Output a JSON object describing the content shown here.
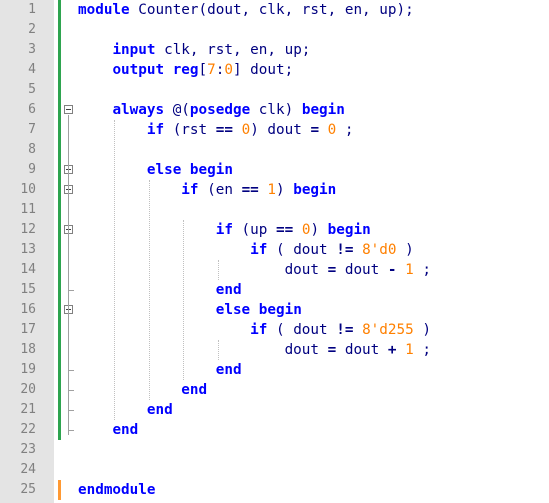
{
  "editor": {
    "lines": [
      {
        "n": "1",
        "tokens": [
          {
            "t": "module",
            "c": "kw"
          },
          {
            "t": " Counter(dout, clk, rst, en, up);",
            "c": "id"
          }
        ]
      },
      {
        "n": "2",
        "tokens": []
      },
      {
        "n": "3",
        "tokens": [
          {
            "t": "    ",
            "c": "id"
          },
          {
            "t": "input",
            "c": "kw"
          },
          {
            "t": " clk, rst, en, up;",
            "c": "id"
          }
        ]
      },
      {
        "n": "4",
        "tokens": [
          {
            "t": "    ",
            "c": "id"
          },
          {
            "t": "output",
            "c": "kw"
          },
          {
            "t": " ",
            "c": "id"
          },
          {
            "t": "reg",
            "c": "kw"
          },
          {
            "t": "[",
            "c": "id"
          },
          {
            "t": "7",
            "c": "num"
          },
          {
            "t": ":",
            "c": "id"
          },
          {
            "t": "0",
            "c": "num"
          },
          {
            "t": "] dout;",
            "c": "id"
          }
        ]
      },
      {
        "n": "5",
        "tokens": []
      },
      {
        "n": "6",
        "tokens": [
          {
            "t": "    ",
            "c": "id"
          },
          {
            "t": "always",
            "c": "kw"
          },
          {
            "t": " @(",
            "c": "id"
          },
          {
            "t": "posedge",
            "c": "kw"
          },
          {
            "t": " clk) ",
            "c": "id"
          },
          {
            "t": "begin",
            "c": "kw"
          }
        ]
      },
      {
        "n": "7",
        "tokens": [
          {
            "t": "        ",
            "c": "id"
          },
          {
            "t": "if",
            "c": "kw"
          },
          {
            "t": " (rst ",
            "c": "id"
          },
          {
            "t": "==",
            "c": "op"
          },
          {
            "t": " ",
            "c": "id"
          },
          {
            "t": "0",
            "c": "num"
          },
          {
            "t": ") dout ",
            "c": "id"
          },
          {
            "t": "=",
            "c": "op"
          },
          {
            "t": " ",
            "c": "id"
          },
          {
            "t": "0",
            "c": "num"
          },
          {
            "t": " ;",
            "c": "id"
          }
        ]
      },
      {
        "n": "8",
        "tokens": []
      },
      {
        "n": "9",
        "tokens": [
          {
            "t": "        ",
            "c": "id"
          },
          {
            "t": "else",
            "c": "kw"
          },
          {
            "t": " ",
            "c": "id"
          },
          {
            "t": "begin",
            "c": "kw"
          }
        ]
      },
      {
        "n": "10",
        "tokens": [
          {
            "t": "            ",
            "c": "id"
          },
          {
            "t": "if",
            "c": "kw"
          },
          {
            "t": " (en ",
            "c": "id"
          },
          {
            "t": "==",
            "c": "op"
          },
          {
            "t": " ",
            "c": "id"
          },
          {
            "t": "1",
            "c": "num"
          },
          {
            "t": ") ",
            "c": "id"
          },
          {
            "t": "begin",
            "c": "kw"
          }
        ]
      },
      {
        "n": "11",
        "tokens": []
      },
      {
        "n": "12",
        "tokens": [
          {
            "t": "                ",
            "c": "id"
          },
          {
            "t": "if",
            "c": "kw"
          },
          {
            "t": " (up ",
            "c": "id"
          },
          {
            "t": "==",
            "c": "op"
          },
          {
            "t": " ",
            "c": "id"
          },
          {
            "t": "0",
            "c": "num"
          },
          {
            "t": ") ",
            "c": "id"
          },
          {
            "t": "begin",
            "c": "kw"
          }
        ]
      },
      {
        "n": "13",
        "tokens": [
          {
            "t": "                    ",
            "c": "id"
          },
          {
            "t": "if",
            "c": "kw"
          },
          {
            "t": " ( dout ",
            "c": "id"
          },
          {
            "t": "!=",
            "c": "op"
          },
          {
            "t": " ",
            "c": "id"
          },
          {
            "t": "8'd0",
            "c": "num"
          },
          {
            "t": " )",
            "c": "id"
          }
        ]
      },
      {
        "n": "14",
        "tokens": [
          {
            "t": "                        dout ",
            "c": "id"
          },
          {
            "t": "=",
            "c": "op"
          },
          {
            "t": " dout ",
            "c": "id"
          },
          {
            "t": "-",
            "c": "op"
          },
          {
            "t": " ",
            "c": "id"
          },
          {
            "t": "1",
            "c": "num"
          },
          {
            "t": " ;",
            "c": "id"
          }
        ]
      },
      {
        "n": "15",
        "tokens": [
          {
            "t": "                ",
            "c": "id"
          },
          {
            "t": "end",
            "c": "kw"
          }
        ]
      },
      {
        "n": "16",
        "tokens": [
          {
            "t": "                ",
            "c": "id"
          },
          {
            "t": "else",
            "c": "kw"
          },
          {
            "t": " ",
            "c": "id"
          },
          {
            "t": "begin",
            "c": "kw"
          }
        ]
      },
      {
        "n": "17",
        "tokens": [
          {
            "t": "                    ",
            "c": "id"
          },
          {
            "t": "if",
            "c": "kw"
          },
          {
            "t": " ( dout ",
            "c": "id"
          },
          {
            "t": "!=",
            "c": "op"
          },
          {
            "t": " ",
            "c": "id"
          },
          {
            "t": "8'd255",
            "c": "num"
          },
          {
            "t": " )",
            "c": "id"
          }
        ]
      },
      {
        "n": "18",
        "tokens": [
          {
            "t": "                        dout ",
            "c": "id"
          },
          {
            "t": "=",
            "c": "op"
          },
          {
            "t": " dout ",
            "c": "id"
          },
          {
            "t": "+",
            "c": "op"
          },
          {
            "t": " ",
            "c": "id"
          },
          {
            "t": "1",
            "c": "num"
          },
          {
            "t": " ;",
            "c": "id"
          }
        ]
      },
      {
        "n": "19",
        "tokens": [
          {
            "t": "                ",
            "c": "id"
          },
          {
            "t": "end",
            "c": "kw"
          }
        ]
      },
      {
        "n": "20",
        "tokens": [
          {
            "t": "            ",
            "c": "id"
          },
          {
            "t": "end",
            "c": "kw"
          }
        ]
      },
      {
        "n": "21",
        "tokens": [
          {
            "t": "        ",
            "c": "id"
          },
          {
            "t": "end",
            "c": "kw"
          }
        ]
      },
      {
        "n": "22",
        "tokens": [
          {
            "t": "    ",
            "c": "id"
          },
          {
            "t": "end",
            "c": "kw"
          }
        ]
      },
      {
        "n": "23",
        "tokens": []
      },
      {
        "n": "24",
        "tokens": []
      },
      {
        "n": "25",
        "tokens": [
          {
            "t": "endmodule",
            "c": "kw"
          }
        ]
      }
    ],
    "colors": {
      "keyword": "#0000ff",
      "number": "#ff8000",
      "identifier": "#000080",
      "saved_change_bar": "#2ea44f",
      "unsaved_change_bar": "#ff9933",
      "gutter": "#e4e4e4"
    }
  }
}
